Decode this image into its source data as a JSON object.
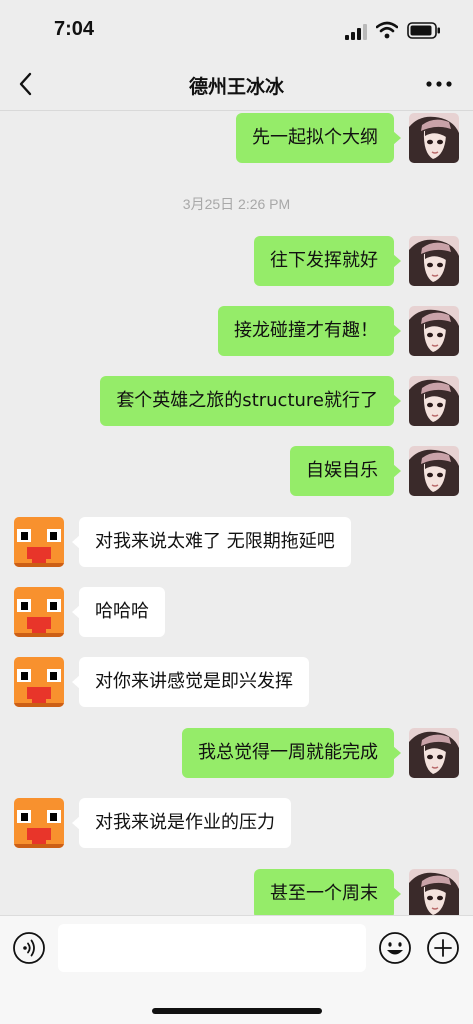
{
  "status_bar": {
    "time": "7:04"
  },
  "nav": {
    "title": "德州王冰冰"
  },
  "messages": [
    {
      "side": "out",
      "text": "先一起拟个大纲"
    },
    {
      "timestamp": "3月25日 2:26 PM"
    },
    {
      "side": "out",
      "text": "往下发挥就好"
    },
    {
      "side": "out",
      "text": "接龙碰撞才有趣！"
    },
    {
      "side": "out",
      "text": "套个英雄之旅的structure就行了"
    },
    {
      "side": "out",
      "text": "自娱自乐"
    },
    {
      "side": "in",
      "text": "对我来说太难了 无限期拖延吧"
    },
    {
      "side": "in",
      "text": "哈哈哈"
    },
    {
      "side": "in",
      "text": "对你来讲感觉是即兴发挥"
    },
    {
      "side": "out",
      "text": "我总觉得一周就能完成"
    },
    {
      "side": "in",
      "text": "对我来说是作业的压力"
    },
    {
      "side": "out",
      "text": "甚至一个周末"
    }
  ],
  "input_bar": {
    "placeholder": ""
  },
  "colors": {
    "outgoing_bubble": "#95ec69",
    "incoming_bubble": "#ffffff",
    "background": "#ededed"
  },
  "icons": [
    "back-icon",
    "more-icon",
    "voice-icon",
    "emoji-icon",
    "plus-icon"
  ]
}
